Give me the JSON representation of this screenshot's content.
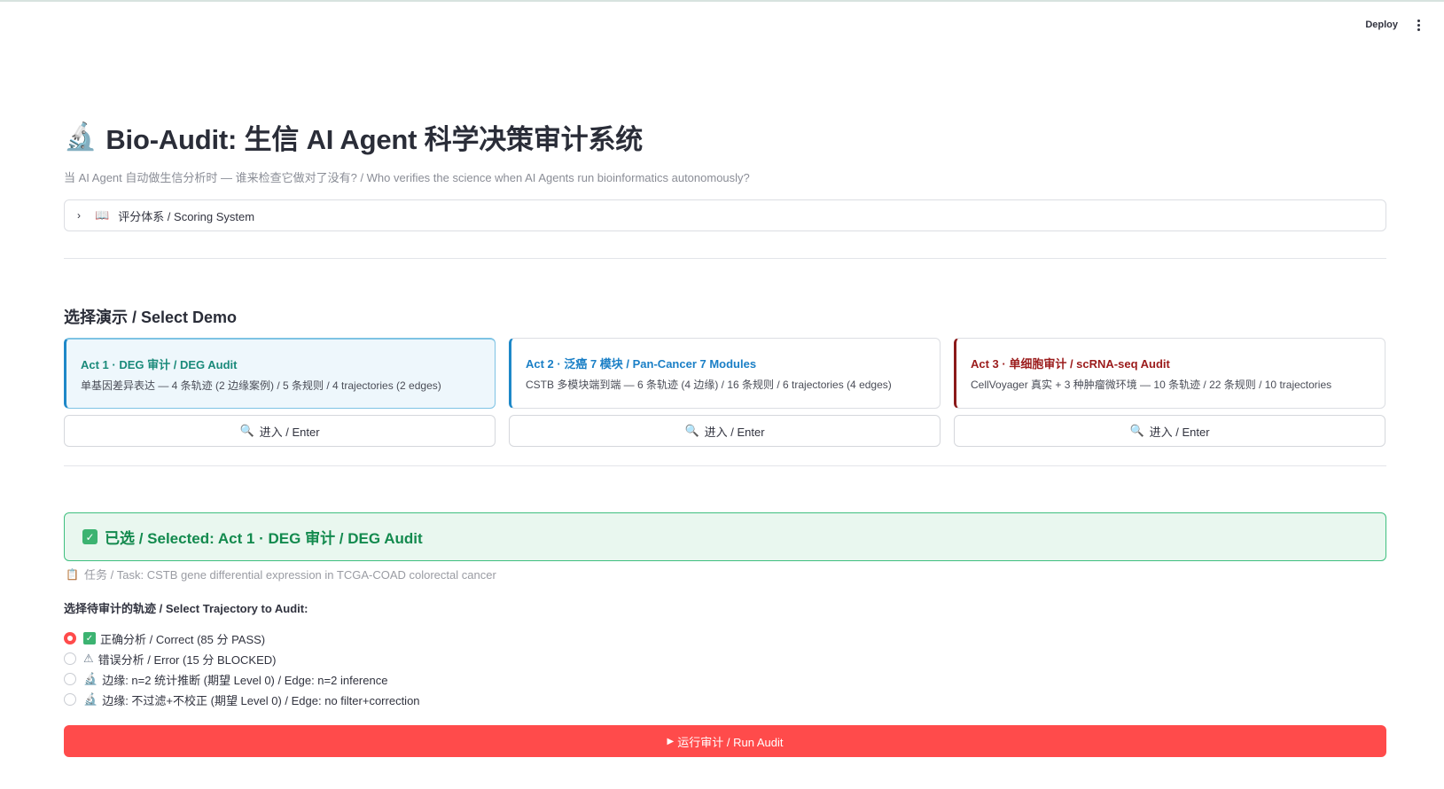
{
  "header": {
    "deploy_label": "Deploy"
  },
  "page": {
    "title_icon": "microscope-icon",
    "title": "Bio-Audit: 生信 AI Agent 科学决策审计系统",
    "subtitle": "当 AI Agent 自动做生信分析时 — 谁来检查它做对了没有? / Who verifies the science when AI Agents run bioinformatics autonomously?"
  },
  "expander": {
    "label": "评分体系 / Scoring System"
  },
  "demo": {
    "section_title": "选择演示 / Select Demo",
    "cards": [
      {
        "title": "Act 1 · DEG 审计 / DEG Audit",
        "desc": "单基因差异表达 — 4 条轨迹 (2 边缘案例) / 5 条规则 / 4 trajectories (2 edges)",
        "enter_label": "进入 / Enter",
        "accent": "#1a8a7a"
      },
      {
        "title": "Act 2 · 泛癌 7 模块 / Pan-Cancer 7 Modules",
        "desc": "CSTB 多模块端到端 — 6 条轨迹 (4 边缘) / 16 条规则 / 6 trajectories (4 edges)",
        "enter_label": "进入 / Enter",
        "accent": "#1a7fc6"
      },
      {
        "title": "Act 3 · 单细胞审计 / scRNA-seq Audit",
        "desc": "CellVoyager 真实 + 3 种肿瘤微环境 — 10 条轨迹 / 22 条规则 / 10 trajectories",
        "enter_label": "进入 / Enter",
        "accent": "#9b1b1b"
      }
    ]
  },
  "selected": {
    "text": "已选 / Selected: Act 1 · DEG 审计 / DEG Audit",
    "task": "任务 / Task: CSTB gene differential expression in TCGA-COAD colorectal cancer"
  },
  "trajectory": {
    "label": "选择待审计的轨迹 / Select Trajectory to Audit:",
    "options": [
      {
        "label": "正确分析 / Correct (85 分 PASS)",
        "icon": "check-icon",
        "selected": true
      },
      {
        "label": "错误分析 / Error (15 分 BLOCKED)",
        "icon": "warning-icon",
        "selected": false
      },
      {
        "label": "边缘: n=2 统计推断 (期望 Level 0) / Edge: n=2 inference",
        "icon": "microscope-icon",
        "selected": false
      },
      {
        "label": "边缘: 不过滤+不校正 (期望 Level 0) / Edge: no filter+correction",
        "icon": "microscope-icon",
        "selected": false
      }
    ]
  },
  "run": {
    "label": "运行审计 / Run Audit"
  },
  "colors": {
    "primary": "#ff4b4b",
    "success": "#3cb371",
    "success_text": "#138a4e"
  }
}
